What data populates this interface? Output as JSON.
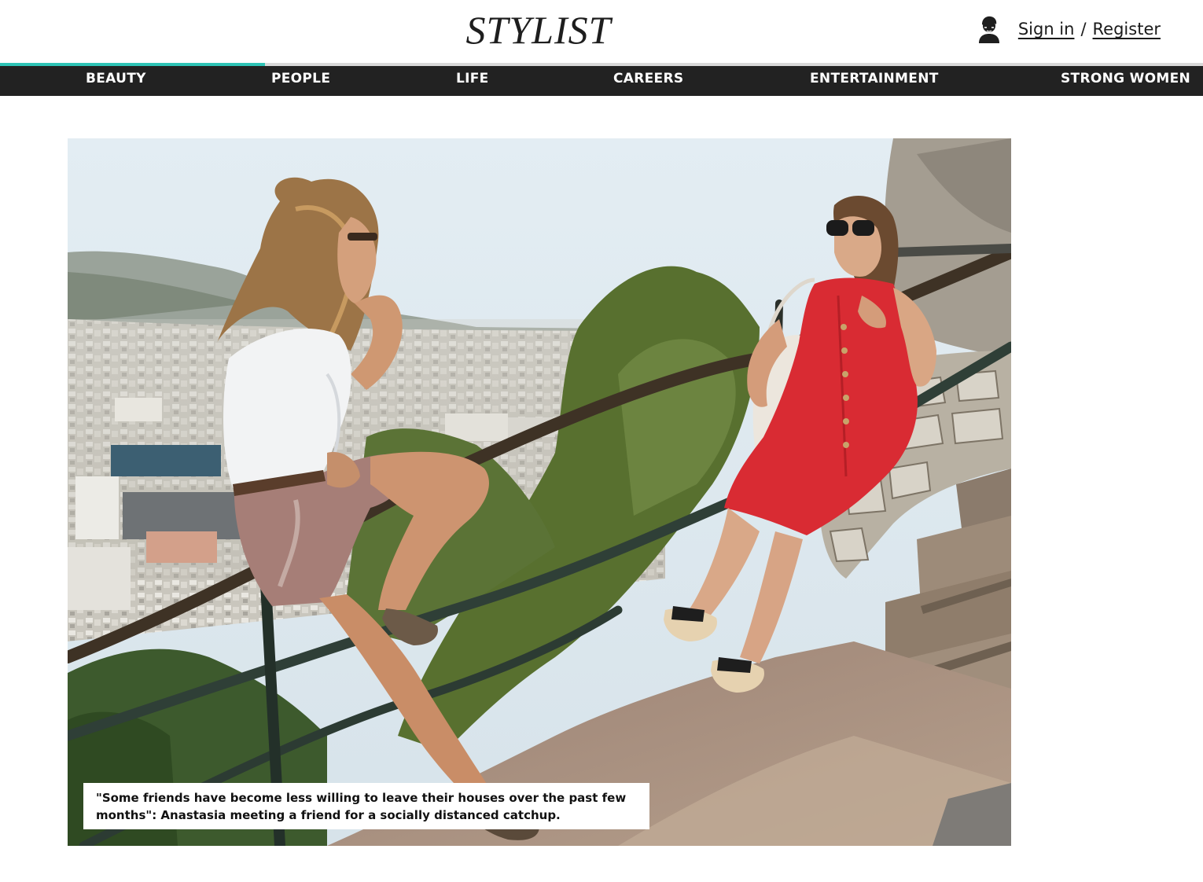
{
  "header": {
    "logo": "STYLIST",
    "account": {
      "icon": "user-avatar-icon",
      "sign_in": "Sign in",
      "separator": "/",
      "register": "Register"
    }
  },
  "nav": {
    "progress": 0.22,
    "accent_color": "#2ec4b6",
    "items": [
      {
        "label": "BEAUTY"
      },
      {
        "label": "PEOPLE"
      },
      {
        "label": "LIFE"
      },
      {
        "label": "CAREERS"
      },
      {
        "label": "ENTERTAINMENT"
      },
      {
        "label": "STRONG WOMEN"
      }
    ]
  },
  "article": {
    "image": {
      "caption": "\"Some friends have become less willing to leave their houses over the past few months\": Anastasia meeting a friend for a socially distanced catchup."
    }
  }
}
